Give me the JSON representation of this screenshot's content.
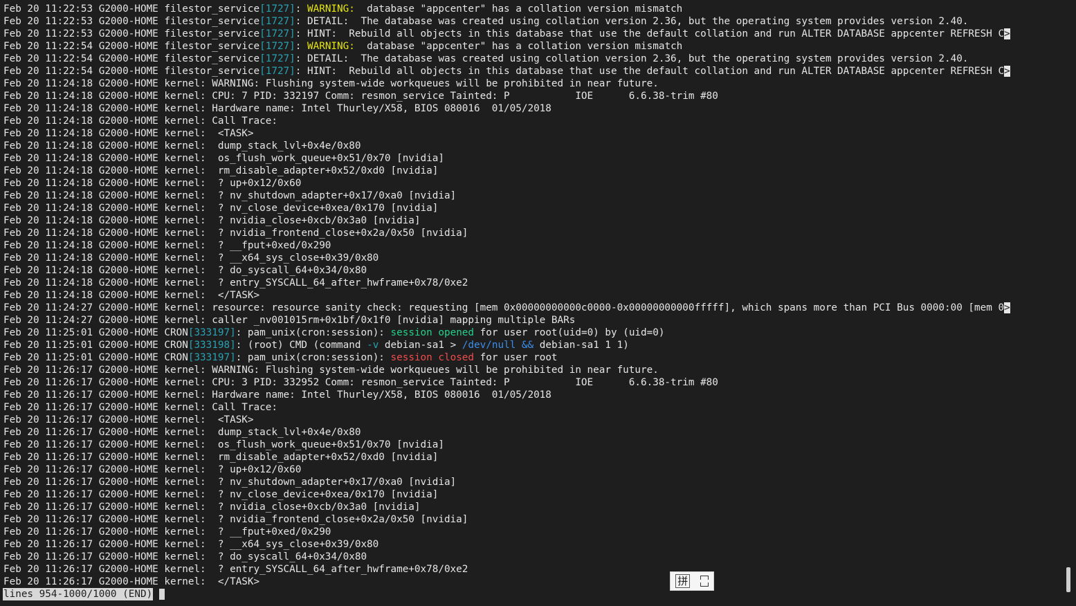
{
  "log_lines": [
    {
      "kind": "warn",
      "prefix": "Feb 20 11:22:53 G2000-HOME filestor_service",
      "pid": "[1727]",
      "tag": "WARNING:",
      "msg": "  database \"appcenter\" has a collation version mismatch",
      "truncated": false
    },
    {
      "kind": "pidmsg",
      "prefix": "Feb 20 11:22:53 G2000-HOME filestor_service",
      "pid": "[1727]",
      "msg": ": DETAIL:  The database was created using collation version 2.36, but the operating system provides version 2.40.",
      "truncated": false
    },
    {
      "kind": "pidmsg",
      "prefix": "Feb 20 11:22:53 G2000-HOME filestor_service",
      "pid": "[1727]",
      "msg": ": HINT:  Rebuild all objects in this database that use the default collation and run ALTER DATABASE appcenter REFRESH C",
      "truncated": true
    },
    {
      "kind": "warn",
      "prefix": "Feb 20 11:22:54 G2000-HOME filestor_service",
      "pid": "[1727]",
      "tag": "WARNING:",
      "msg": "  database \"appcenter\" has a collation version mismatch",
      "truncated": false
    },
    {
      "kind": "pidmsg",
      "prefix": "Feb 20 11:22:54 G2000-HOME filestor_service",
      "pid": "[1727]",
      "msg": ": DETAIL:  The database was created using collation version 2.36, but the operating system provides version 2.40.",
      "truncated": false
    },
    {
      "kind": "pidmsg",
      "prefix": "Feb 20 11:22:54 G2000-HOME filestor_service",
      "pid": "[1727]",
      "msg": ": HINT:  Rebuild all objects in this database that use the default collation and run ALTER DATABASE appcenter REFRESH C",
      "truncated": true
    },
    {
      "kind": "plain",
      "text": "Feb 20 11:24:18 G2000-HOME kernel: WARNING: Flushing system-wide workqueues will be prohibited in near future."
    },
    {
      "kind": "plain",
      "text": "Feb 20 11:24:18 G2000-HOME kernel: CPU: 7 PID: 332197 Comm: resmon_service Tainted: P           IOE      6.6.38-trim #80"
    },
    {
      "kind": "plain",
      "text": "Feb 20 11:24:18 G2000-HOME kernel: Hardware name: Intel Thurley/X58, BIOS 080016  01/05/2018"
    },
    {
      "kind": "plain",
      "text": "Feb 20 11:24:18 G2000-HOME kernel: Call Trace:"
    },
    {
      "kind": "plain",
      "text": "Feb 20 11:24:18 G2000-HOME kernel:  <TASK>"
    },
    {
      "kind": "plain",
      "text": "Feb 20 11:24:18 G2000-HOME kernel:  dump_stack_lvl+0x4e/0x80"
    },
    {
      "kind": "plain",
      "text": "Feb 20 11:24:18 G2000-HOME kernel:  os_flush_work_queue+0x51/0x70 [nvidia]"
    },
    {
      "kind": "plain",
      "text": "Feb 20 11:24:18 G2000-HOME kernel:  rm_disable_adapter+0x52/0xd0 [nvidia]"
    },
    {
      "kind": "plain",
      "text": "Feb 20 11:24:18 G2000-HOME kernel:  ? up+0x12/0x60"
    },
    {
      "kind": "plain",
      "text": "Feb 20 11:24:18 G2000-HOME kernel:  ? nv_shutdown_adapter+0x17/0xa0 [nvidia]"
    },
    {
      "kind": "plain",
      "text": "Feb 20 11:24:18 G2000-HOME kernel:  ? nv_close_device+0xea/0x170 [nvidia]"
    },
    {
      "kind": "plain",
      "text": "Feb 20 11:24:18 G2000-HOME kernel:  ? nvidia_close+0xcb/0x3a0 [nvidia]"
    },
    {
      "kind": "plain",
      "text": "Feb 20 11:24:18 G2000-HOME kernel:  ? nvidia_frontend_close+0x2a/0x50 [nvidia]"
    },
    {
      "kind": "plain",
      "text": "Feb 20 11:24:18 G2000-HOME kernel:  ? __fput+0xed/0x290"
    },
    {
      "kind": "plain",
      "text": "Feb 20 11:24:18 G2000-HOME kernel:  ? __x64_sys_close+0x39/0x80"
    },
    {
      "kind": "plain",
      "text": "Feb 20 11:24:18 G2000-HOME kernel:  ? do_syscall_64+0x34/0x80"
    },
    {
      "kind": "plain",
      "text": "Feb 20 11:24:18 G2000-HOME kernel:  ? entry_SYSCALL_64_after_hwframe+0x78/0xe2"
    },
    {
      "kind": "plain",
      "text": "Feb 20 11:24:18 G2000-HOME kernel:  </TASK>"
    },
    {
      "kind": "plain_trunc",
      "text": "Feb 20 11:24:27 G2000-HOME kernel: resource: resource sanity check: requesting [mem 0x00000000000c0000-0x00000000000fffff], which spans more than PCI Bus 0000:00 [mem 0"
    },
    {
      "kind": "plain",
      "text": "Feb 20 11:24:27 G2000-HOME kernel: caller _nv001015rm+0x1bf/0x1f0 [nvidia] mapping multiple BARs"
    },
    {
      "kind": "session",
      "prefix": "Feb 20 11:25:01 G2000-HOME CRON",
      "pid": "[333197]",
      "pre": ": pam_unix(cron:session): ",
      "state": "session opened",
      "state_class": "ok",
      "post": " for user root(uid=0) by (uid=0)"
    },
    {
      "kind": "cmd",
      "prefix": "Feb 20 11:25:01 G2000-HOME CRON",
      "pid": "[333198]",
      "pre": ": (root) CMD (command ",
      "flag": "-v",
      "mid": " debian-sa1 > ",
      "path": "/dev/null",
      "sp": " ",
      "op": "&&",
      "post": " debian-sa1 1 1)"
    },
    {
      "kind": "session",
      "prefix": "Feb 20 11:25:01 G2000-HOME CRON",
      "pid": "[333197]",
      "pre": ": pam_unix(cron:session): ",
      "state": "session closed",
      "state_class": "bad",
      "post": " for user root"
    },
    {
      "kind": "plain",
      "text": "Feb 20 11:26:17 G2000-HOME kernel: WARNING: Flushing system-wide workqueues will be prohibited in near future."
    },
    {
      "kind": "plain",
      "text": "Feb 20 11:26:17 G2000-HOME kernel: CPU: 3 PID: 332952 Comm: resmon_service Tainted: P           IOE      6.6.38-trim #80"
    },
    {
      "kind": "plain",
      "text": "Feb 20 11:26:17 G2000-HOME kernel: Hardware name: Intel Thurley/X58, BIOS 080016  01/05/2018"
    },
    {
      "kind": "plain",
      "text": "Feb 20 11:26:17 G2000-HOME kernel: Call Trace:"
    },
    {
      "kind": "plain",
      "text": "Feb 20 11:26:17 G2000-HOME kernel:  <TASK>"
    },
    {
      "kind": "plain",
      "text": "Feb 20 11:26:17 G2000-HOME kernel:  dump_stack_lvl+0x4e/0x80"
    },
    {
      "kind": "plain",
      "text": "Feb 20 11:26:17 G2000-HOME kernel:  os_flush_work_queue+0x51/0x70 [nvidia]"
    },
    {
      "kind": "plain",
      "text": "Feb 20 11:26:17 G2000-HOME kernel:  rm_disable_adapter+0x52/0xd0 [nvidia]"
    },
    {
      "kind": "plain",
      "text": "Feb 20 11:26:17 G2000-HOME kernel:  ? up+0x12/0x60"
    },
    {
      "kind": "plain",
      "text": "Feb 20 11:26:17 G2000-HOME kernel:  ? nv_shutdown_adapter+0x17/0xa0 [nvidia]"
    },
    {
      "kind": "plain",
      "text": "Feb 20 11:26:17 G2000-HOME kernel:  ? nv_close_device+0xea/0x170 [nvidia]"
    },
    {
      "kind": "plain",
      "text": "Feb 20 11:26:17 G2000-HOME kernel:  ? nvidia_close+0xcb/0x3a0 [nvidia]"
    },
    {
      "kind": "plain",
      "text": "Feb 20 11:26:17 G2000-HOME kernel:  ? nvidia_frontend_close+0x2a/0x50 [nvidia]"
    },
    {
      "kind": "plain",
      "text": "Feb 20 11:26:17 G2000-HOME kernel:  ? __fput+0xed/0x290"
    },
    {
      "kind": "plain",
      "text": "Feb 20 11:26:17 G2000-HOME kernel:  ? __x64_sys_close+0x39/0x80"
    },
    {
      "kind": "plain",
      "text": "Feb 20 11:26:17 G2000-HOME kernel:  ? do_syscall_64+0x34/0x80"
    },
    {
      "kind": "plain",
      "text": "Feb 20 11:26:17 G2000-HOME kernel:  ? entry_SYSCALL_64_after_hwframe+0x78/0xe2"
    },
    {
      "kind": "plain",
      "text": "Feb 20 11:26:17 G2000-HOME kernel:  </TASK>"
    }
  ],
  "truncation_marker": ">",
  "status_bar": {
    "text": "lines 954-1000/1000 (END)"
  },
  "ime": {
    "mode_label": "拼",
    "width_mode_icon": "full-width-icon"
  },
  "colors": {
    "background": "#1e1e1e",
    "text": "#e6e6e6",
    "pid": "#2aa1b3",
    "warning": "#e5e510",
    "session_opened": "#23d18b",
    "session_closed": "#f14c4c",
    "path": "#3b8eea"
  }
}
